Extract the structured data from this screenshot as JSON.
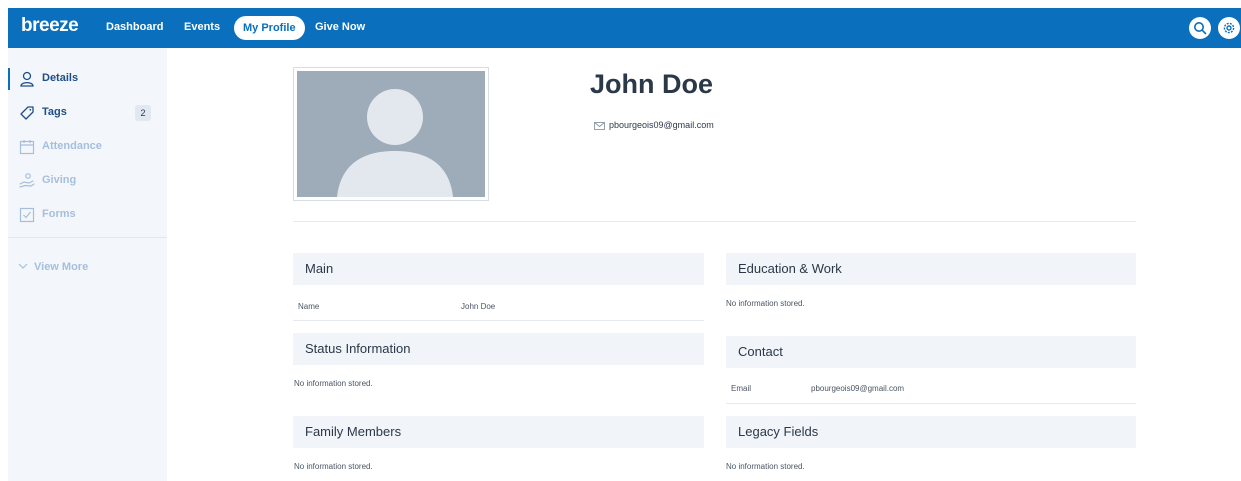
{
  "app": {
    "logo": "breeze"
  },
  "nav": {
    "dashboard": "Dashboard",
    "events": "Events",
    "my_profile": "My Profile",
    "give_now": "Give Now"
  },
  "sidebar": {
    "items": [
      {
        "label": "Details",
        "icon": "person-icon"
      },
      {
        "label": "Tags",
        "icon": "tag-icon",
        "badge": "2"
      },
      {
        "label": "Attendance",
        "icon": "calendar-icon"
      },
      {
        "label": "Giving",
        "icon": "hand-coins-icon"
      },
      {
        "label": "Forms",
        "icon": "checkbox-icon"
      }
    ],
    "view_more": "View More"
  },
  "profile": {
    "name": "John Doe",
    "email": "pbourgeois09@gmail.com"
  },
  "sections": {
    "main": {
      "title": "Main",
      "name_label": "Name",
      "name_value": "John Doe"
    },
    "education": {
      "title": "Education & Work",
      "empty": "No information stored."
    },
    "status": {
      "title": "Status Information",
      "empty": "No information stored."
    },
    "contact": {
      "title": "Contact",
      "email_label": "Email",
      "email_value": "pbourgeois09@gmail.com"
    },
    "family": {
      "title": "Family Members",
      "empty": "No information stored."
    },
    "legacy": {
      "title": "Legacy Fields",
      "empty": "No information stored."
    }
  },
  "colors": {
    "brand": "#0a6fbd",
    "sidebar_bg": "#f3f6fa",
    "section_bg": "#f1f4f8",
    "placeholder": "#9eacba"
  }
}
